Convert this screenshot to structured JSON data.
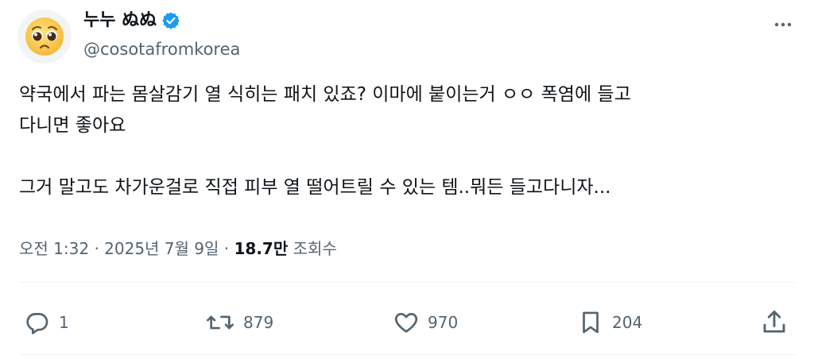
{
  "author": {
    "display_name": "누누 ぬぬ",
    "handle": "@cosotafromkorea",
    "avatar_icon": "pleading-face-emoji",
    "verified": true,
    "verified_color": "#1d9bf0"
  },
  "tweet": {
    "lines": [
      "약국에서 파는 몸살감기 열 식히는 패치 있죠? 이마에 붙이는거 ㅇㅇ 폭염에 들고",
      "다니면 좋아요",
      "",
      "그거 말고도 차가운걸로 직접 피부 열 떨어트릴 수 있는 템..뭐든 들고다니자..."
    ]
  },
  "meta": {
    "time": "오전 1:32",
    "sep1": "·",
    "date": "2025년 7월 9일",
    "sep2": "·",
    "views": "18.7만",
    "views_label": "조회수"
  },
  "actions": {
    "replies": "1",
    "retweets": "879",
    "likes": "970",
    "bookmarks": "204"
  },
  "colors": {
    "text": "#0f1419",
    "secondary": "#536471",
    "divider": "#eff3f4"
  }
}
